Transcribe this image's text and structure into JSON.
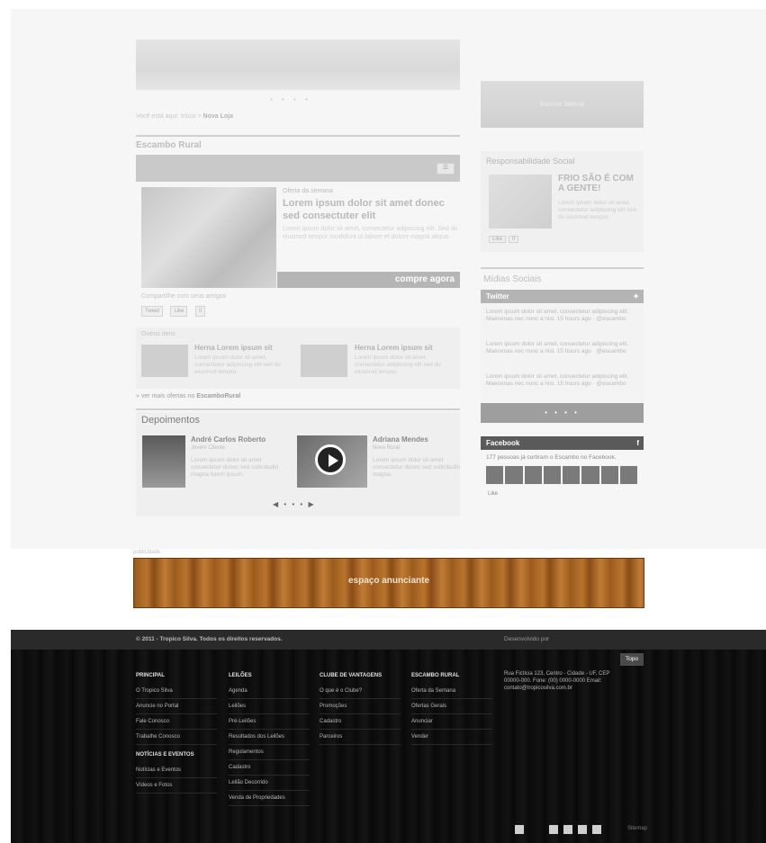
{
  "breadcrumb": {
    "prefix": "Você está aqui: Início >",
    "current": "Nova Loja"
  },
  "section_rural": {
    "title": "Escambo Rural"
  },
  "product": {
    "kicker": "Oferta da semana",
    "title": "Lorem ipsum dolor sit amet donec sed consectuter elit",
    "body": "Lorem ipsum dolor sit amet, consectetur adipiscing elit. Sed do eiusmod tempor incididunt ut labore et dolore magna aliqua.",
    "buy_label": "compre agora"
  },
  "share": {
    "label": "Compartilhe com seus amigos",
    "buttons": [
      "Tweet",
      "Like",
      "0"
    ]
  },
  "related": {
    "label": "Outros itens",
    "items": [
      {
        "title": "Herna Lorem ipsum sit",
        "body": "Lorem ipsum dolor sit amet, consectetur adipiscing elit sed do eiusmod tempor."
      },
      {
        "title": "Herna Lorem ipsum sit",
        "body": "Lorem ipsum dolor sit amet, consectetur adipiscing elit sed do eiusmod tempor."
      }
    ],
    "more_prefix": "» ver mais ofertas no",
    "more_link": "EscamboRural"
  },
  "depoimentos": {
    "title": "Depoimentos",
    "items": [
      {
        "name": "André Carlos Roberto",
        "role": "Jovem Cliente",
        "text": "Lorem ipsum dolor sit amet consectetur donec sed sollicitudin magna lorem ipsum."
      },
      {
        "name": "Adriana Mendes",
        "role": "Nova Rural",
        "text": "Lorem ipsum dolor sit amet consectetur donec sed sollicitudin magna."
      }
    ]
  },
  "sidebar": {
    "banner": "banner lateral",
    "social_resp": {
      "title": "Responsabilidade Social",
      "headline": "FRIO SÃO É COM A GENTE!",
      "body": "Lorem ipsum dolor sit amet, consectetur adipiscing elit sed do eiusmod tempor.",
      "buttons": [
        "Like",
        "0"
      ]
    },
    "midias_title": "Mídias Sociais",
    "twitter": {
      "title": "Twitter",
      "items": [
        "Lorem ipsum dolor sit amet, consectetur adipiscing elit. Maecenas nec nunc a nisi. 15 hours ago · @escambo",
        "Lorem ipsum dolor sit amet, consectetur adipiscing elit. Maecenas nec nunc a nisi. 15 hours ago · @escambo",
        "Lorem ipsum dolor sit amet, consectetur adipiscing elit. Maecenas nec nunc a nisi. 15 hours ago · @escambo"
      ],
      "pager": "• • • •"
    },
    "facebook": {
      "title": "Facebook",
      "text": "177 pessoas já curtiram o Escambo no Facebook.",
      "like": "Like"
    }
  },
  "ad": {
    "label": "publicidade",
    "text": "espaço anunciante"
  },
  "footer": {
    "copyright": "© 2011 - Tropico Silva. Todos os direitos reservados.",
    "credit": "Desenvolvido por",
    "top_label": "Topo",
    "columns": [
      {
        "title": "PRINCIPAL",
        "links": [
          "O Tropico Silva",
          "Anuncie no Portal",
          "Fale Conosco",
          "Trabalhe Conosco"
        ]
      },
      {
        "title": "LEILÕES",
        "links": [
          "Agenda",
          "Leilões",
          "Pré-Leilões",
          "Resultados dos Leilões",
          "Regulamentos",
          "Cadastro",
          "Leilão Decorrido",
          "Venda de Propriedades"
        ]
      },
      {
        "title": "CLUBE DE VANTAGENS",
        "links": [
          "O que é o Clube?",
          "Promoções",
          "Cadastro",
          "Parceiros"
        ]
      },
      {
        "title": "ESCAMBO RURAL",
        "links": [
          "Oferta da Semana",
          "Ofertas Gerais",
          "Anunciar",
          "Vender"
        ]
      }
    ],
    "news_column": {
      "title": "NOTÍCIAS E EVENTOS",
      "links": [
        "Notícias e Eventos",
        "Vídeos e Fotos"
      ]
    },
    "address": "Rua Fictícia 123, Centro - Cidade - UF, CEP 00000-000. Fone: (00) 0000-0000 Email: contato@tropicosilva.com.br",
    "mini": "Sitemap"
  }
}
